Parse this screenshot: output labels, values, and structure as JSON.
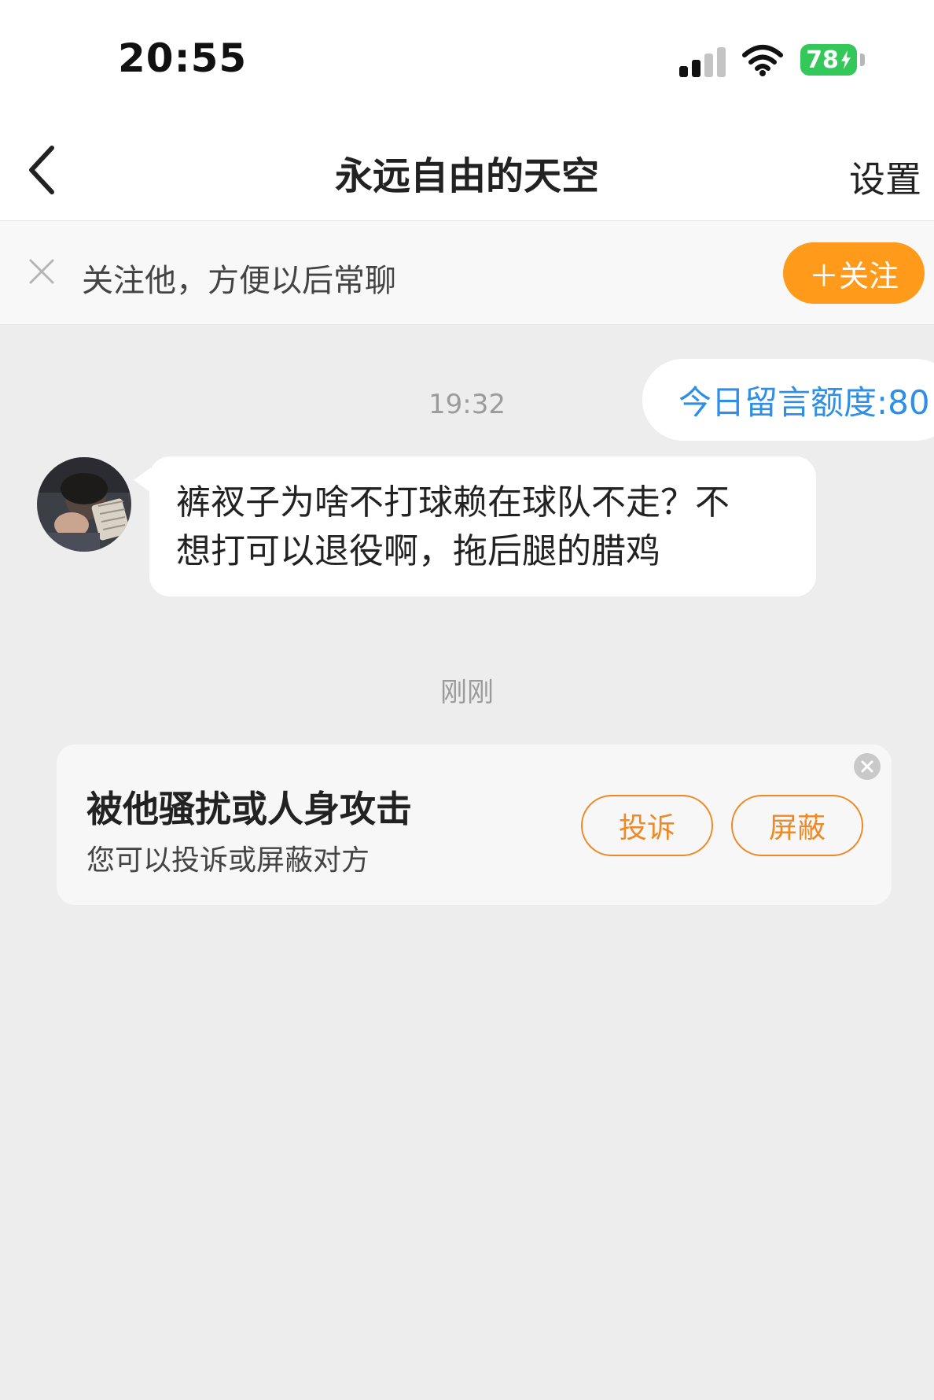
{
  "status_bar": {
    "time": "20:55",
    "battery": "78"
  },
  "nav": {
    "title": "永远自由的天空",
    "settings_label": "设置"
  },
  "follow_banner": {
    "text": "关注他，方便以后常聊",
    "follow_label": "＋关注"
  },
  "chat": {
    "timestamp_1": "19:32",
    "quota": "今日留言额度:80",
    "message": {
      "line1": "裤衩子为啥不打球赖在球队不走？不",
      "line2": "想打可以退役啊，拖后腿的腊鸡"
    },
    "timestamp_2": "刚刚"
  },
  "report_card": {
    "title": "被他骚扰或人身攻击",
    "subtitle": "您可以投诉或屏蔽对方",
    "complain_label": "投诉",
    "block_label": "屏蔽"
  },
  "colors": {
    "accent_orange": "#ff9a1a",
    "outline_orange": "#ee8a26",
    "link_blue": "#2f8fe6",
    "battery_green": "#34c759",
    "chat_background": "#ededed"
  }
}
